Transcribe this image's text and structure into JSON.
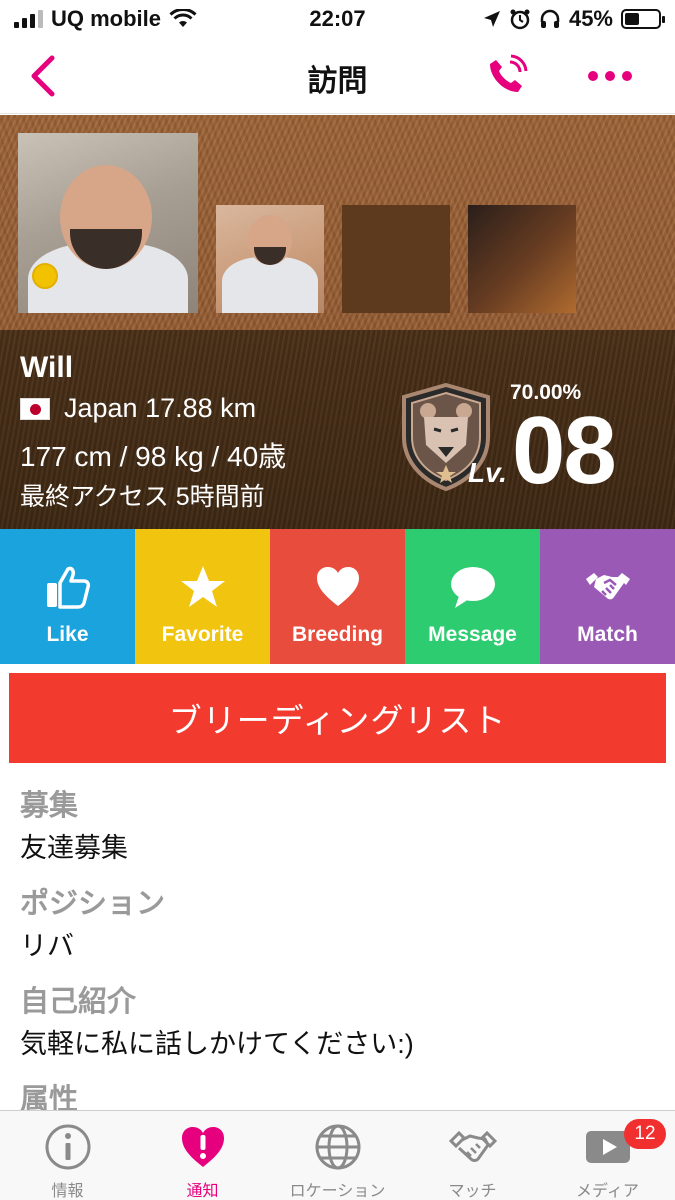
{
  "status_bar": {
    "carrier": "UQ mobile",
    "time": "22:07",
    "battery": "45%",
    "battery_level": 0.45
  },
  "nav": {
    "title": "訪問",
    "icons": {
      "back": "chevron-left-icon",
      "call": "phone-icon",
      "more": "more-dots-icon"
    }
  },
  "profile": {
    "name": "Will",
    "location": "Japan 17.88 km",
    "body": "177 cm / 98 kg / 40歳",
    "last_access": "最終アクセス 5時間前",
    "online": true,
    "locked_count": "2",
    "level_percent": "70.00%",
    "level_label": "Lv.",
    "level": "08",
    "colors": {
      "wood": "#9c6236",
      "dark_wood": "#4a3018",
      "online_dot": "#f2c200"
    }
  },
  "actions": [
    {
      "label": "Like",
      "icon": "thumbs-up-icon",
      "color": "#1aa3dd"
    },
    {
      "label": "Favorite",
      "icon": "star-icon",
      "color": "#f1c40f"
    },
    {
      "label": "Breeding",
      "icon": "heart-icon",
      "color": "#e74c3c"
    },
    {
      "label": "Message",
      "icon": "chat-bubble-icon",
      "color": "#2ecc71"
    },
    {
      "label": "Match",
      "icon": "handshake-icon",
      "color": "#9b59b6"
    }
  ],
  "breeding_list_button": "ブリーディングリスト",
  "details": [
    {
      "label": "募集",
      "value": "友達募集"
    },
    {
      "label": "ポジション",
      "value": "リバ"
    },
    {
      "label": "自己紹介",
      "value": "気軽に私に話しかけてください:)"
    },
    {
      "label": "属性",
      "value": ""
    }
  ],
  "tabs": [
    {
      "label": "情報",
      "icon": "info-icon",
      "active": false
    },
    {
      "label": "通知",
      "icon": "alert-heart-icon",
      "active": true
    },
    {
      "label": "ロケーション",
      "icon": "globe-icon",
      "active": false
    },
    {
      "label": "マッチ",
      "icon": "handshake-icon",
      "active": false
    },
    {
      "label": "メディア",
      "icon": "play-icon",
      "active": false,
      "badge": "12"
    }
  ],
  "accent_color": "#e6007e"
}
